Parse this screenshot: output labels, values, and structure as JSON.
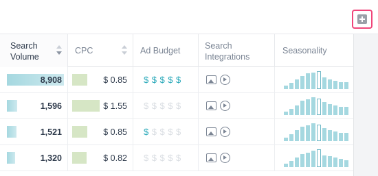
{
  "headers": {
    "search_volume_line1": "Search",
    "search_volume_line2": "Volume",
    "cpc": "CPC",
    "ad_budget": "Ad Budget",
    "integrations_line1": "Search",
    "integrations_line2": "Integrations",
    "seasonality": "Seasonality"
  },
  "colors": {
    "volume_bar": "#a5d8e0",
    "cpc_bar": "#d6e6c5",
    "dollar_active": "#25a7b8",
    "dollar_inactive": "#d9dde2",
    "highlight": "#f0457a"
  },
  "icons": {
    "add_column": "plus-square-icon",
    "image": "image-icon",
    "video": "play-circle-icon"
  },
  "rows": [
    {
      "volume": "8,908",
      "volume_fill": 1.0,
      "cpc": "$ 0.85",
      "cpc_fill": 0.55,
      "ad_budget_level": 5,
      "seasonality": [
        3,
        5,
        8,
        11,
        13,
        14,
        15,
        10,
        8,
        7,
        6,
        6
      ]
    },
    {
      "volume": "1,596",
      "volume_fill": 0.18,
      "cpc": "$ 1.55",
      "cpc_fill": 1.0,
      "ad_budget_level": 0,
      "seasonality": [
        3,
        5,
        8,
        12,
        13,
        15,
        14,
        11,
        9,
        8,
        7,
        7
      ]
    },
    {
      "volume": "1,521",
      "volume_fill": 0.17,
      "cpc": "$ 0.85",
      "cpc_fill": 0.55,
      "ad_budget_level": 1,
      "seasonality": [
        3,
        6,
        9,
        12,
        13,
        15,
        14,
        11,
        9,
        8,
        7,
        7
      ]
    },
    {
      "volume": "1,320",
      "volume_fill": 0.15,
      "cpc": "$ 0.82",
      "cpc_fill": 0.53,
      "ad_budget_level": 0,
      "seasonality": [
        3,
        5,
        8,
        11,
        12,
        14,
        15,
        10,
        9,
        8,
        7,
        6
      ]
    }
  ],
  "seasonality_peak_index": 6,
  "dollar_symbol": "$",
  "dollar_count": 5
}
